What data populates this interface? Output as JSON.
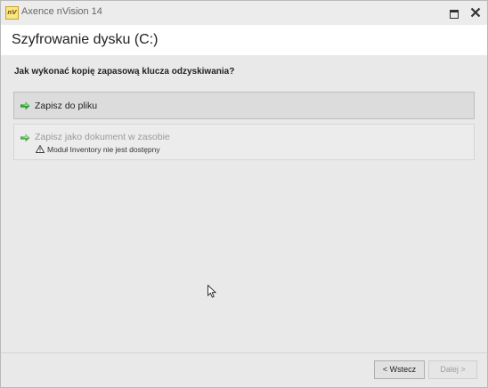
{
  "window": {
    "app_title": "Axence nVision 14",
    "icon": "nvision-logo-icon",
    "icon_text": "nV"
  },
  "header": {
    "title": "Szyfrowanie dysku (C:)"
  },
  "main": {
    "question": "Jak wykonać kopię zapasową klucza odzyskiwania?",
    "options": [
      {
        "label": "Zapisz do pliku",
        "icon": "green-arrow-icon",
        "enabled": true
      },
      {
        "label": "Zapisz jako dokument w zasobie",
        "icon": "green-arrow-icon",
        "enabled": false,
        "warning": "Moduł Inventory nie jest dostępny",
        "warning_icon": "warning-icon"
      }
    ]
  },
  "footer": {
    "back_label": "< Wstecz",
    "next_label": "Dalej >",
    "next_enabled": false
  },
  "colors": {
    "arrow_green": "#2ea02e",
    "arrow_light": "#7dd27d",
    "disabled_text": "#9a9a9a"
  }
}
